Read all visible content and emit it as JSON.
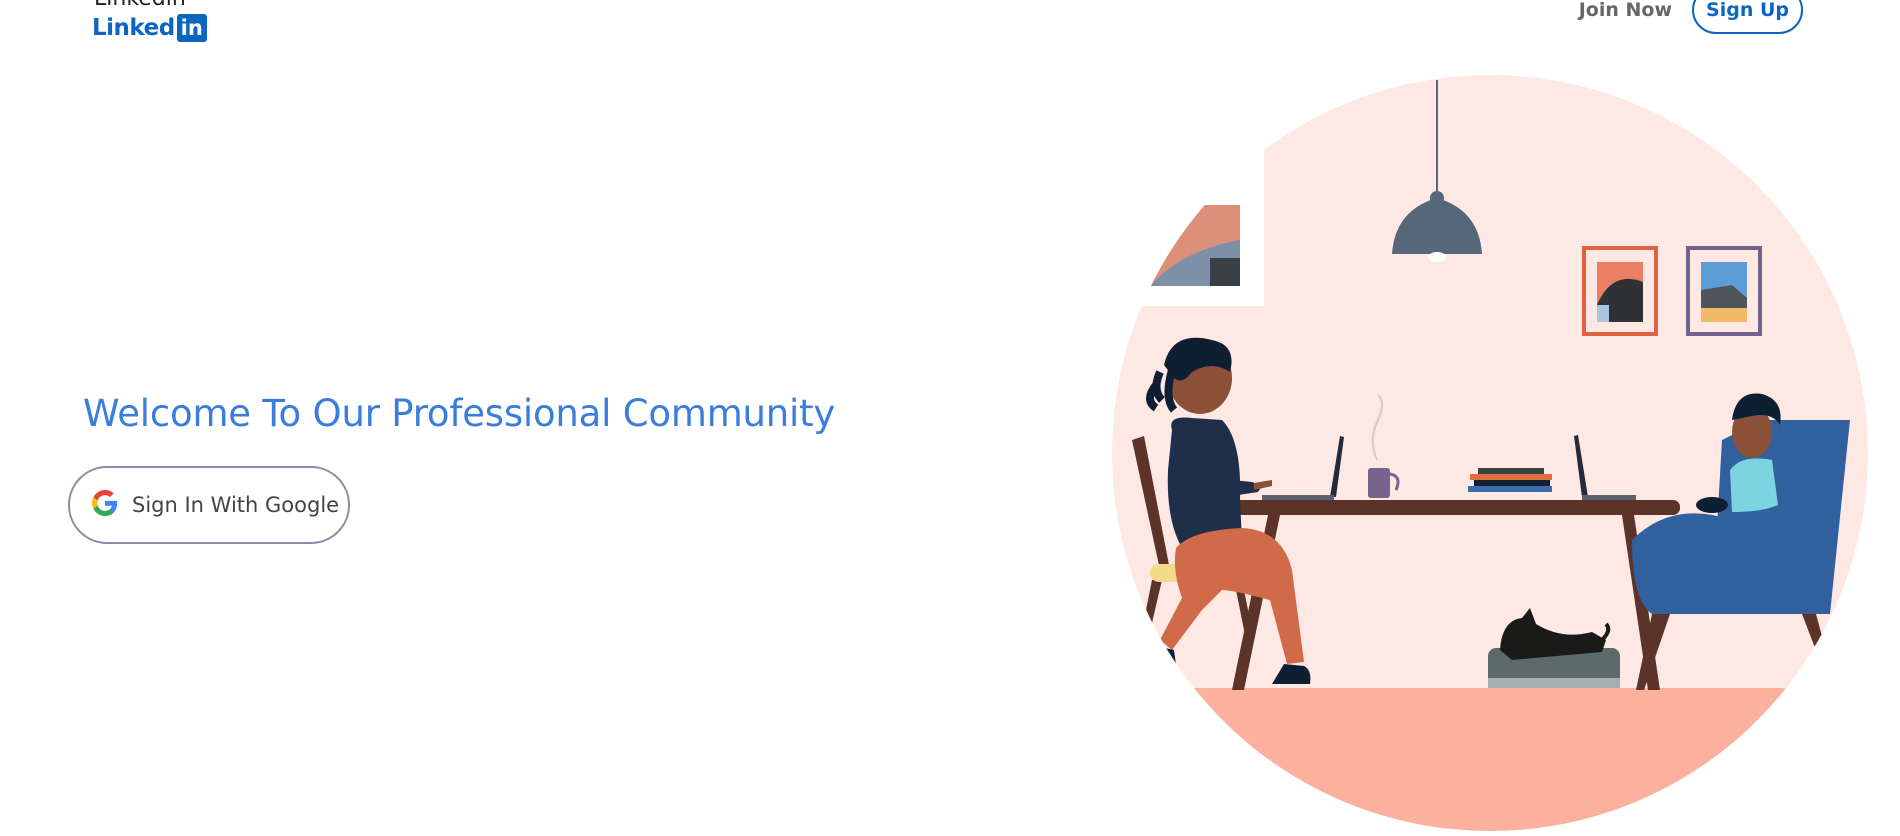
{
  "header": {
    "app_title": "Linkedin",
    "logo": {
      "word": "Linked",
      "badge": "in"
    },
    "nav": {
      "join_label": "Join Now",
      "signup_label": "Sign Up"
    }
  },
  "main": {
    "title": "Welcome To Our Professional Community",
    "google_button": {
      "label": "Sign In With Google",
      "icon": "google-g-icon"
    }
  },
  "illustration": {
    "name": "people-working-at-table-illustration",
    "colors": {
      "circle_bg": "#fde8e4",
      "floor": "#fbb19d",
      "table": "#5b3328",
      "chair_blue": "#30609e",
      "shirt_dark": "#1f2f4a",
      "lamp": "#56677a"
    }
  },
  "theme": {
    "accent": "#0a66c2",
    "title_blue": "#3b7ddd"
  }
}
